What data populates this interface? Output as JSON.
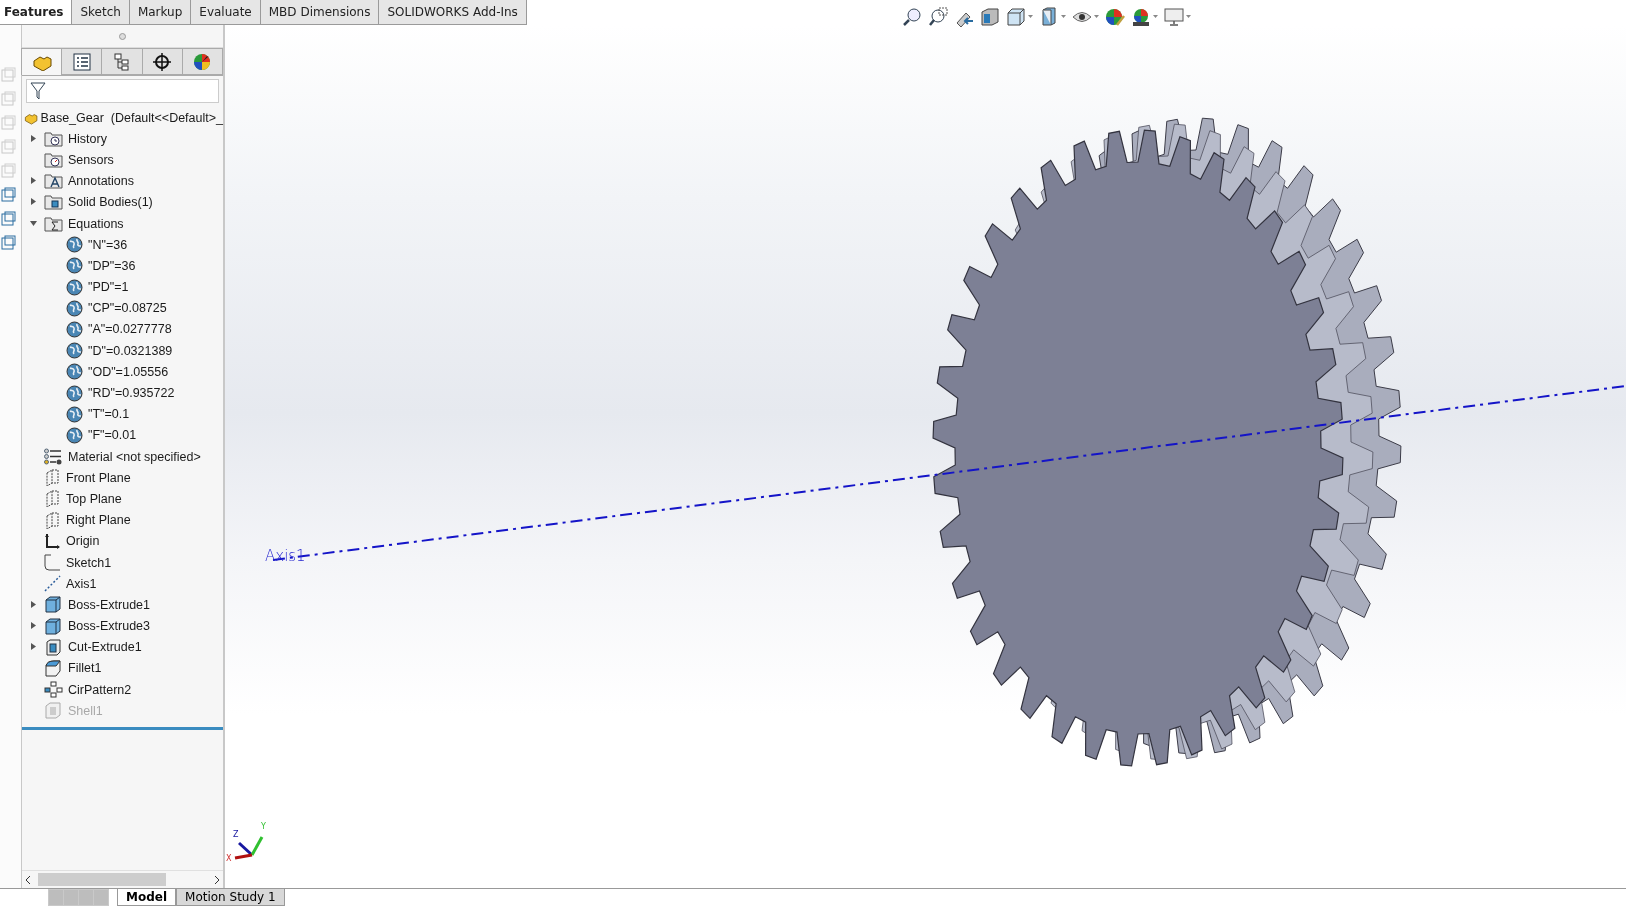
{
  "command_tabs": [
    {
      "label": "Features",
      "selected": true
    },
    {
      "label": "Sketch",
      "selected": false
    },
    {
      "label": "Markup",
      "selected": false
    },
    {
      "label": "Evaluate",
      "selected": false
    },
    {
      "label": "MBD Dimensions",
      "selected": false
    },
    {
      "label": "SOLIDWORKS Add-Ins",
      "selected": false
    }
  ],
  "panel_tabs": [
    {
      "kind": "features",
      "selected": true
    },
    {
      "kind": "properties",
      "selected": false
    },
    {
      "kind": "configurations",
      "selected": false
    },
    {
      "kind": "dimxpert",
      "selected": false
    },
    {
      "kind": "display",
      "selected": false
    }
  ],
  "tree": {
    "root": "Base_Gear  (Default<<Default>_",
    "items": [
      {
        "label": "History",
        "kind": "history",
        "expanded": false,
        "suppressed": false
      },
      {
        "label": "Sensors",
        "kind": "sensors",
        "suppressed": false
      },
      {
        "label": "Annotations",
        "kind": "annotations",
        "expanded": false,
        "suppressed": false
      },
      {
        "label": "Solid Bodies(1)",
        "kind": "bodies",
        "expanded": false,
        "suppressed": false
      },
      {
        "label": "Equations",
        "kind": "equations",
        "expanded": true,
        "suppressed": false,
        "children": [
          {
            "label": "\"N\"=36",
            "kind": "equation",
            "suppressed": false
          },
          {
            "label": "\"DP\"=36",
            "kind": "equation",
            "suppressed": false
          },
          {
            "label": "\"PD\"=1",
            "kind": "equation",
            "suppressed": false
          },
          {
            "label": "\"CP\"=0.08725",
            "kind": "equation",
            "suppressed": false
          },
          {
            "label": "\"A\"=0.0277778",
            "kind": "equation",
            "suppressed": false
          },
          {
            "label": "\"D\"=0.0321389",
            "kind": "equation",
            "suppressed": false
          },
          {
            "label": "\"OD\"=1.05556",
            "kind": "equation",
            "suppressed": false
          },
          {
            "label": "\"RD\"=0.935722",
            "kind": "equation",
            "suppressed": false
          },
          {
            "label": "\"T\"=0.1",
            "kind": "equation",
            "suppressed": false
          },
          {
            "label": "\"F\"=0.01",
            "kind": "equation",
            "suppressed": false
          }
        ]
      },
      {
        "label": "Material <not specified>",
        "kind": "material",
        "suppressed": false
      },
      {
        "label": "Front Plane",
        "kind": "plane",
        "suppressed": false
      },
      {
        "label": "Top Plane",
        "kind": "plane",
        "suppressed": false
      },
      {
        "label": "Right Plane",
        "kind": "plane",
        "suppressed": false
      },
      {
        "label": "Origin",
        "kind": "origin",
        "suppressed": false
      },
      {
        "label": "Sketch1",
        "kind": "sketch",
        "suppressed": false
      },
      {
        "label": "Axis1",
        "kind": "axis",
        "suppressed": false
      },
      {
        "label": "Boss-Extrude1",
        "kind": "extrude",
        "expanded": false,
        "suppressed": false
      },
      {
        "label": "Boss-Extrude3",
        "kind": "extrude",
        "expanded": false,
        "suppressed": false
      },
      {
        "label": "Cut-Extrude1",
        "kind": "cut",
        "expanded": false,
        "suppressed": false
      },
      {
        "label": "Fillet1",
        "kind": "fillet",
        "suppressed": false
      },
      {
        "label": "CirPattern2",
        "kind": "pattern",
        "suppressed": false
      },
      {
        "label": "Shell1",
        "kind": "shell",
        "suppressed": true
      }
    ]
  },
  "viewport": {
    "axis_label": "Axis1",
    "triad": {
      "x": "X",
      "y": "Y",
      "z": "Z"
    }
  },
  "bottom_tabs": [
    {
      "label": "Model",
      "selected": true
    },
    {
      "label": "Motion Study 1",
      "selected": false
    }
  ]
}
